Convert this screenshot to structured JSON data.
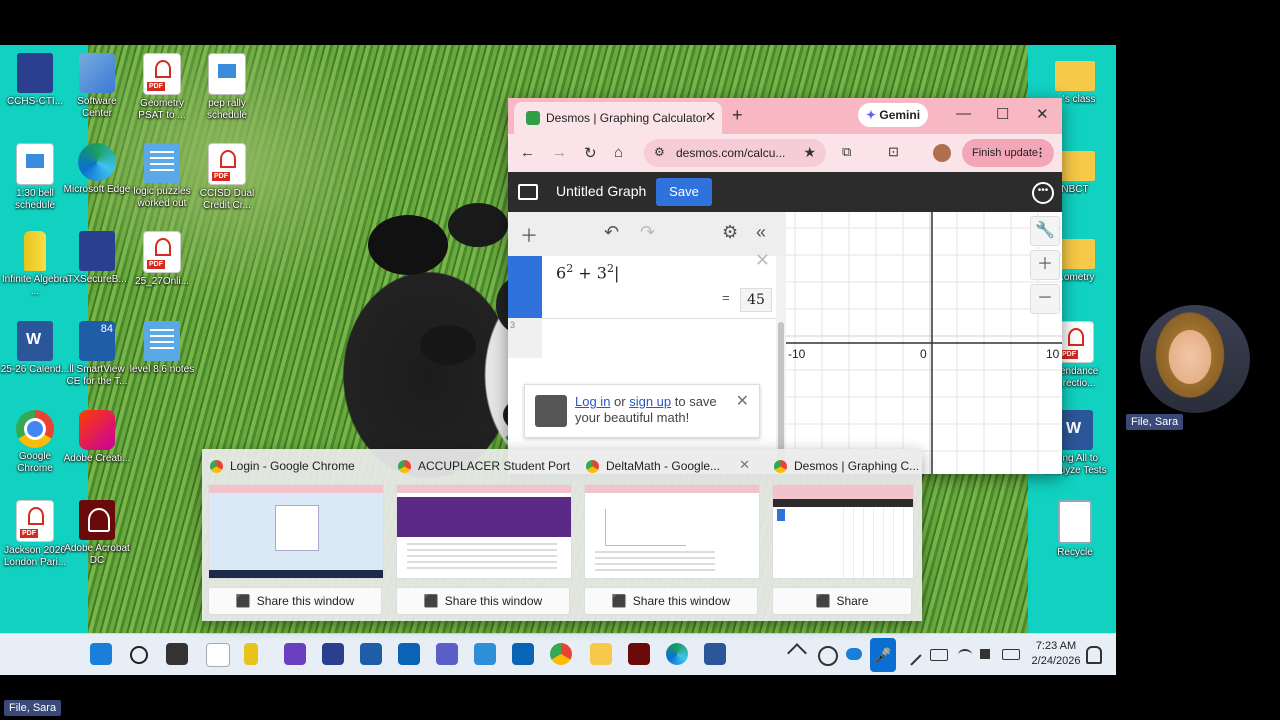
{
  "desktop_icons": [
    {
      "label": "CCHS-CTI...",
      "icon": "chart-icon"
    },
    {
      "label": "Software Center",
      "icon": "software-center-icon"
    },
    {
      "label": "Geometry PSAT to ...",
      "icon": "pdf-icon"
    },
    {
      "label": "pep rally schedule",
      "icon": "image-file-icon"
    },
    {
      "label": "1:30 bell schedule",
      "icon": "image-file-icon"
    },
    {
      "label": "Microsoft Edge",
      "icon": "edge-icon"
    },
    {
      "label": "logic puzzles worked out",
      "icon": "notes-icon"
    },
    {
      "label": "CCISD Dual Credit Cr...",
      "icon": "pdf-icon"
    },
    {
      "label": "Infinite Algebra ...",
      "icon": "pencil-icon"
    },
    {
      "label": "TXSecureB...",
      "icon": "app-icon"
    },
    {
      "label": "25_27Onli...",
      "icon": "pdf-icon"
    },
    {
      "label": "25-26 Calend...",
      "icon": "word-icon"
    },
    {
      "label": "ll SmartView CE for the T...",
      "icon": "smartview-icon"
    },
    {
      "label": "level 8.6 notes",
      "icon": "notes-icon"
    },
    {
      "label": "Google Chrome",
      "icon": "chrome-icon"
    },
    {
      "label": "Adobe Creati...",
      "icon": "creative-cloud-icon"
    },
    {
      "label": "Jackson 2026 London Pari...",
      "icon": "pdf-icon"
    },
    {
      "label": "Adobe Acrobat DC",
      "icon": "acrobat-icon"
    },
    {
      "label": "...'s class",
      "icon": "folder-icon"
    },
    {
      "label": "NBCT",
      "icon": "folder-icon"
    },
    {
      "label": "...ometry",
      "icon": "folder-icon"
    },
    {
      "label": "...endance ...rectio...",
      "icon": "pdf-icon"
    },
    {
      "label": "...ing All to ...nalyze Tests",
      "icon": "word-icon"
    },
    {
      "label": "Recycle",
      "icon": "recycle-bin-icon"
    }
  ],
  "browser": {
    "tab_title": "Desmos | Graphing Calculator",
    "tab_close": "✕",
    "new_tab": "+",
    "gemini_label": "Gemini",
    "url": "desmos.com/calcu...",
    "finish_update": "Finish update",
    "minimize": "—",
    "maximize": "☐",
    "close": "✕"
  },
  "desmos": {
    "graph_title": "Untitled Graph",
    "save_label": "Save",
    "expression": {
      "base1": "6",
      "exp1": "2",
      "plus": "+",
      "base2": "3",
      "exp2": "2"
    },
    "result_eq": "=",
    "result": "45",
    "next_row_number": "3",
    "login_prompt": {
      "log_in": "Log in",
      "or": " or ",
      "sign_up": "sign up",
      "rest": " to save your beautiful math!"
    },
    "axis_labels": {
      "xmin": "-10",
      "origin": "0",
      "xmax": "10"
    }
  },
  "preview_windows": [
    {
      "title": "Login - Google Chrome",
      "share": "Share this window"
    },
    {
      "title": "ACCUPLACER Student Porta...",
      "share": "Share this window"
    },
    {
      "title": "DeltaMath - Google...",
      "share": "Share this window"
    },
    {
      "title": "Desmos | Graphing C...",
      "share": "Share"
    }
  ],
  "taskbar": {
    "time": "7:23 AM",
    "date": "2/24/2026"
  },
  "participant": {
    "name_chip_1": "File, Sara",
    "name_chip_2": "File, Sara"
  },
  "colors": {
    "desktop_bg": "#11d1c1",
    "tab_bar": "#f7b8c4",
    "desmos_blue": "#2f72dc"
  }
}
